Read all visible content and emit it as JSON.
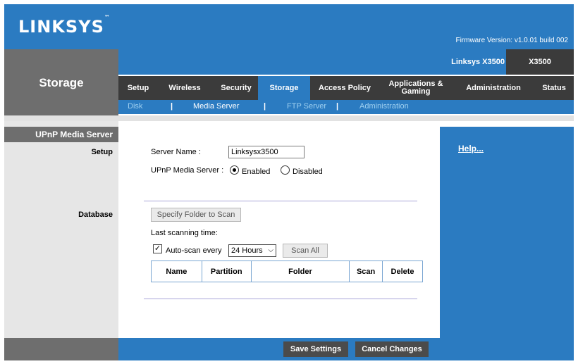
{
  "header": {
    "logo_text": "LINKSYS",
    "logo_mark": "™",
    "firmware": "Firmware Version: v1.0.01 build 002",
    "model_name": "Linksys X3500",
    "model_badge": "X3500"
  },
  "section_title": "Storage",
  "tabs": [
    {
      "label": "Setup",
      "active": false
    },
    {
      "label": "Wireless",
      "active": false
    },
    {
      "label": "Security",
      "active": false
    },
    {
      "label": "Storage",
      "active": true
    },
    {
      "label": "Access Policy",
      "active": false
    },
    {
      "label": "Applications & Gaming",
      "active": false
    },
    {
      "label": "Administration",
      "active": false
    },
    {
      "label": "Status",
      "active": false
    }
  ],
  "subtabs": [
    {
      "label": "Disk",
      "active": false
    },
    {
      "label": "Media Server",
      "active": true
    },
    {
      "label": "FTP Server",
      "active": false
    },
    {
      "label": "Administration",
      "active": false
    }
  ],
  "subtab_separator": "|",
  "left_panel": {
    "heading": "UPnP Media Server",
    "setup_label": "Setup",
    "database_label": "Database"
  },
  "form": {
    "server_name_label": "Server Name :",
    "server_name_value": "Linksysx3500",
    "upnp_label": "UPnP Media Server :",
    "enabled_label": "Enabled",
    "disabled_label": "Disabled",
    "upnp_state": "Enabled",
    "specify_folder_button": "Specify Folder to Scan",
    "last_scan_label": "Last scanning time:",
    "auto_scan_label": "Auto-scan every",
    "auto_scan_checked": true,
    "auto_scan_value": "24 Hours",
    "scan_all_button": "Scan All",
    "table_headers": [
      "Name",
      "Partition",
      "Folder",
      "Scan",
      "Delete"
    ]
  },
  "help": {
    "link": "Help..."
  },
  "footer": {
    "save_button": "Save Settings",
    "cancel_button": "Cancel Changes"
  }
}
